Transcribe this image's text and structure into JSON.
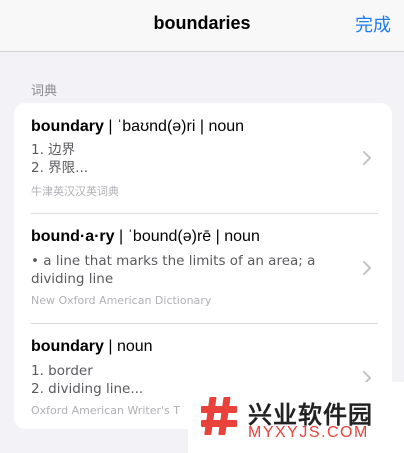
{
  "navbar": {
    "title": "boundaries",
    "done_label": "完成"
  },
  "section": {
    "header": "词典"
  },
  "entries": [
    {
      "headword": "boundary",
      "sep1": " | ",
      "pronunciation": "ˈbaʊnd(ə)ri",
      "sep2": " | ",
      "pos": "noun",
      "definition_lines": [
        "1. 边界",
        "2. 界限..."
      ],
      "source": "牛津英汉汉英词典"
    },
    {
      "headword": "bound·a·ry",
      "sep1": " | ",
      "pronunciation": "ˈbound(ə)rē",
      "sep2": " | ",
      "pos": "noun",
      "definition_lines": [
        "• a line that marks the limits of an area; a",
        "dividing line"
      ],
      "source": "New Oxford American Dictionary"
    },
    {
      "headword": "boundary",
      "sep1": " | ",
      "pos": "noun",
      "definition_lines": [
        "1. border",
        "2. dividing line..."
      ],
      "source": "Oxford American Writer's T"
    }
  ],
  "watermark": {
    "text_cn": "兴业软件园",
    "text_url": "MYXYJS.COM"
  },
  "colors": {
    "accent": "#1e7bf0",
    "watermark_red": "#e8423a"
  }
}
